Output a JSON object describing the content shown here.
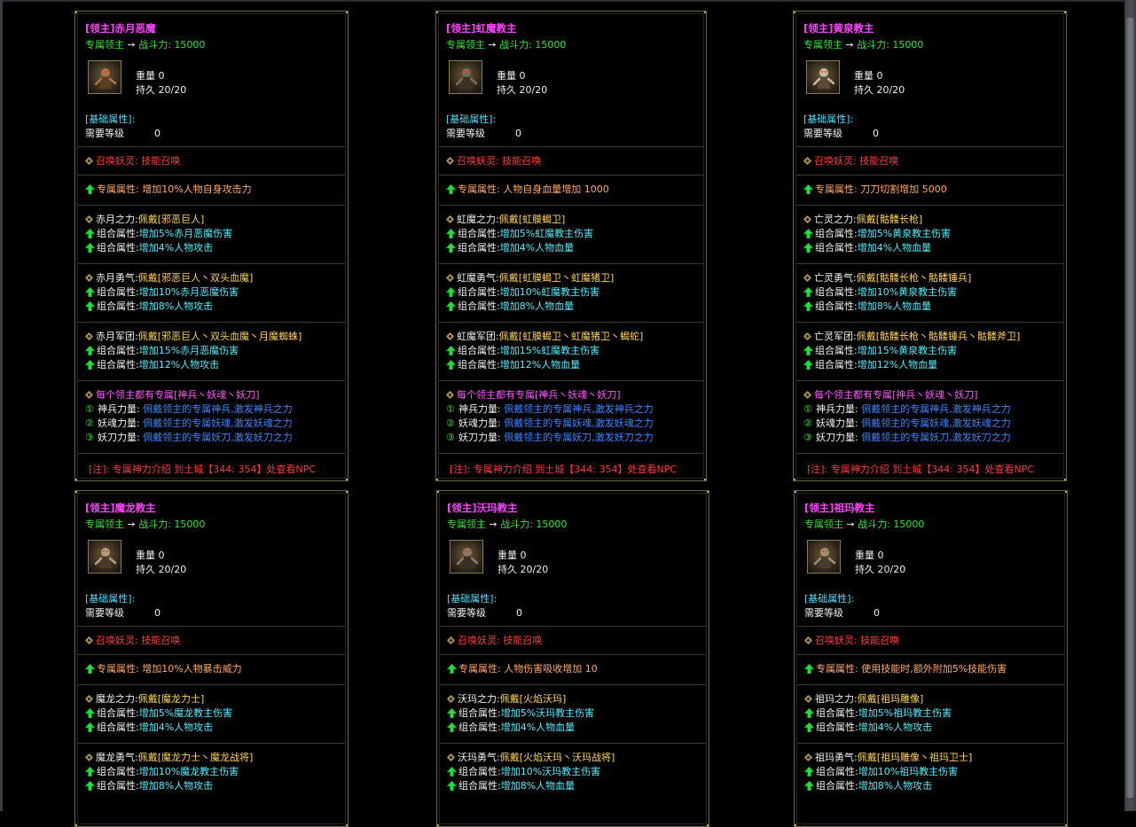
{
  "cards": [
    {
      "title": "[领主]赤月恶魔",
      "subtitle_prefix": "专属领主",
      "subtitle_arrow": "➙",
      "subtitle_suffix": "战斗力: 15000",
      "icon": "evil-demon-icon",
      "weight": "重量 0",
      "durability": "持久 20/20",
      "base_label": "[基础属性]:",
      "level_label": "需要等级",
      "level_value": "0",
      "summon_key": "召唤妖灵:",
      "summon_val": "技能召唤",
      "exclusive_key": "专属属性:",
      "exclusive_val": "增加10%人物自身攻击力",
      "sets": [
        {
          "key": "赤月之力:",
          "val": "佩戴[邪恶巨人]",
          "combo1": "增加5%赤月恶魔伤害",
          "combo2": "增加4%人物攻击"
        },
        {
          "key": "赤月勇气:",
          "val": "佩戴[邪恶巨人丶双头血魔]",
          "combo1": "增加10%赤月恶魔伤害",
          "combo2": "增加8%人物攻击"
        },
        {
          "key": "赤月军团:",
          "val": "佩戴[邪恶巨人丶双头血魔丶月魔蜘蛛]",
          "combo1": "增加15%赤月恶魔伤害",
          "combo2": "增加12%人物攻击"
        }
      ]
    },
    {
      "title": "[领主]虹魔教主",
      "subtitle_prefix": "专属领主",
      "subtitle_arrow": "➙",
      "subtitle_suffix": "战斗力: 15000",
      "icon": "rainbow-demon-icon",
      "weight": "重量 0",
      "durability": "持久 20/20",
      "base_label": "[基础属性]:",
      "level_label": "需要等级",
      "level_value": "0",
      "summon_key": "召唤妖灵:",
      "summon_val": "技能召唤",
      "exclusive_key": "专属属性:",
      "exclusive_val": "人物自身血量增加 1000",
      "sets": [
        {
          "key": "虹魔之力:",
          "val": "佩戴[虹膜蝎卫]",
          "combo1": "增加5%虹魔教主伤害",
          "combo2": "增加4%人物血量"
        },
        {
          "key": "虹魔勇气:",
          "val": "佩戴[虹膜蝎卫丶虹魔猪卫]",
          "combo1": "增加10%虹魔教主伤害",
          "combo2": "增加8%人物血量"
        },
        {
          "key": "虹魔军团:",
          "val": "佩戴[虹膜蝎卫丶虹魔猪卫丶蝎蛇]",
          "combo1": "增加15%虹魔教主伤害",
          "combo2": "增加12%人物血量"
        }
      ]
    },
    {
      "title": "[领主]黄泉教主",
      "subtitle_prefix": "专属领主",
      "subtitle_arrow": "➙",
      "subtitle_suffix": "战斗力: 15000",
      "icon": "skeleton-lord-icon",
      "weight": "重量 0",
      "durability": "持久 20/20",
      "base_label": "[基础属性]:",
      "level_label": "需要等级",
      "level_value": "0",
      "summon_key": "召唤妖灵:",
      "summon_val": "技能召唤",
      "exclusive_key": "专属属性:",
      "exclusive_val": "刀刀切割增加 5000",
      "sets": [
        {
          "key": "亡灵之力:",
          "val": "佩戴[骷髅长枪]",
          "combo1": "增加5%黄泉教主伤害",
          "combo2": "增加4%人物血量"
        },
        {
          "key": "亡灵勇气:",
          "val": "佩戴[骷髅长枪丶骷髅锤兵]",
          "combo1": "增加10%黄泉教主伤害",
          "combo2": "增加8%人物血量"
        },
        {
          "key": "亡灵军团:",
          "val": "佩戴[骷髅长枪丶骷髅锤兵丶骷髅斧卫]",
          "combo1": "增加15%黄泉教主伤害",
          "combo2": "增加12%人物血量"
        }
      ]
    },
    {
      "title": "[领主]魔龙教主",
      "subtitle_prefix": "专属领主",
      "subtitle_arrow": "➙",
      "subtitle_suffix": "战斗力: 15000",
      "icon": "dragon-lord-icon",
      "weight": "重量 0",
      "durability": "持久 20/20",
      "base_label": "[基础属性]:",
      "level_label": "需要等级",
      "level_value": "0",
      "summon_key": "召唤妖灵:",
      "summon_val": "技能召唤",
      "exclusive_key": "专属属性:",
      "exclusive_val": "增加10%人物暴击威力",
      "sets": [
        {
          "key": "魔龙之力:",
          "val": "佩戴[魔龙力士]",
          "combo1": "增加5%魔龙教主伤害",
          "combo2": "增加4%人物攻击"
        },
        {
          "key": "魔龙勇气:",
          "val": "佩戴[魔龙力士丶魔龙战将]",
          "combo1": "增加10%魔龙教主伤害",
          "combo2": "增加8%人物攻击"
        }
      ]
    },
    {
      "title": "[领主]沃玛教主",
      "subtitle_prefix": "专属领主",
      "subtitle_arrow": "➙",
      "subtitle_suffix": "战斗力: 15000",
      "icon": "woma-lord-icon",
      "weight": "重量 0",
      "durability": "持久 20/20",
      "base_label": "[基础属性]:",
      "level_label": "需要等级",
      "level_value": "0",
      "summon_key": "召唤妖灵:",
      "summon_val": "技能召唤",
      "exclusive_key": "专属属性:",
      "exclusive_val": "人物伤害吸收增加 10",
      "sets": [
        {
          "key": "沃玛之力:",
          "val": "佩戴[火焰沃玛]",
          "combo1": "增加5%沃玛教主伤害",
          "combo2": "增加4%人物血量"
        },
        {
          "key": "沃玛勇气:",
          "val": "佩戴[火焰沃玛丶沃玛战将]",
          "combo1": "增加10%沃玛教主伤害",
          "combo2": "增加8%人物血量"
        }
      ]
    },
    {
      "title": "[领主]祖玛教主",
      "subtitle_prefix": "专属领主",
      "subtitle_arrow": "➙",
      "subtitle_suffix": "战斗力: 15000",
      "icon": "zuma-lord-icon",
      "weight": "重量 0",
      "durability": "持久 20/20",
      "base_label": "[基础属性]:",
      "level_label": "需要等级",
      "level_value": "0",
      "summon_key": "召唤妖灵:",
      "summon_val": "技能召唤",
      "exclusive_key": "专属属性:",
      "exclusive_val": "使用技能时,额外附加5%技能伤害",
      "sets": [
        {
          "key": "祖玛之力:",
          "val": "佩戴[祖玛雕像]",
          "combo1": "增加5%祖玛教主伤害",
          "combo2": "增加4%人物攻击"
        },
        {
          "key": "祖玛勇气:",
          "val": "佩戴[祖玛雕像丶祖玛卫士]",
          "combo1": "增加10%祖玛教主伤害",
          "combo2": "增加8%人物攻击"
        }
      ]
    }
  ],
  "common": {
    "combo_key": "组合属性:",
    "weapon_header": "每个领主都有专属[神兵丶妖魂丶妖刀]",
    "weapon_lines": [
      {
        "num": "①",
        "key": "神兵力量:",
        "val": "佩戴领主的专属神兵,激发神兵之力"
      },
      {
        "num": "②",
        "key": "妖魂力量:",
        "val": "佩戴领主的专属妖魂,激发妖魂之力"
      },
      {
        "num": "③",
        "key": "妖刀力量:",
        "val": "佩戴领主的专属妖刀,激发妖刀之力"
      }
    ],
    "note": "[注]: 专属神力介绍 到土城【344: 354】处查看NPC"
  },
  "colors": {
    "title": "#ff44ff",
    "green": "#33e633",
    "red": "#ff3a3a",
    "orange": "#ffaa66",
    "cyan": "#55eeff",
    "blue": "#3b86ff",
    "border": "#6b6345"
  }
}
